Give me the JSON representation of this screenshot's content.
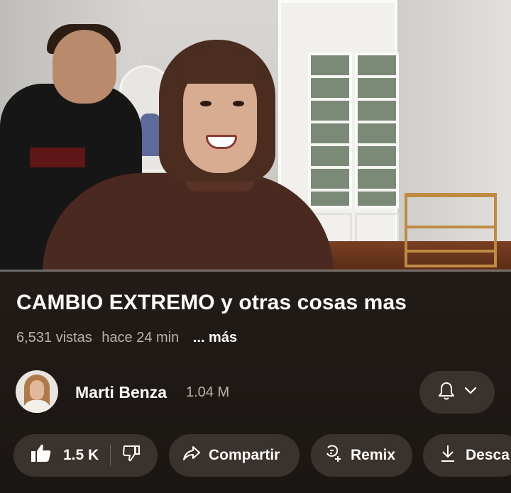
{
  "video": {
    "title": "CAMBIO EXTREMO y otras cosas mas",
    "views": "6,531 vistas",
    "time_ago": "hace 24 min",
    "more_label": "... más",
    "progress_fraction": 0
  },
  "channel": {
    "name": "Marti Benza",
    "subscribers": "1.04 M",
    "avatar_icon": "channel-avatar",
    "notification_icon": "bell-icon"
  },
  "actions": {
    "like_count": "1.5 K",
    "share_label": "Compartir",
    "remix_label": "Remix",
    "download_label": "Desca"
  },
  "colors": {
    "background": "#241d19",
    "pill": "#3a322d",
    "secondary_text": "#b9b3ad"
  }
}
